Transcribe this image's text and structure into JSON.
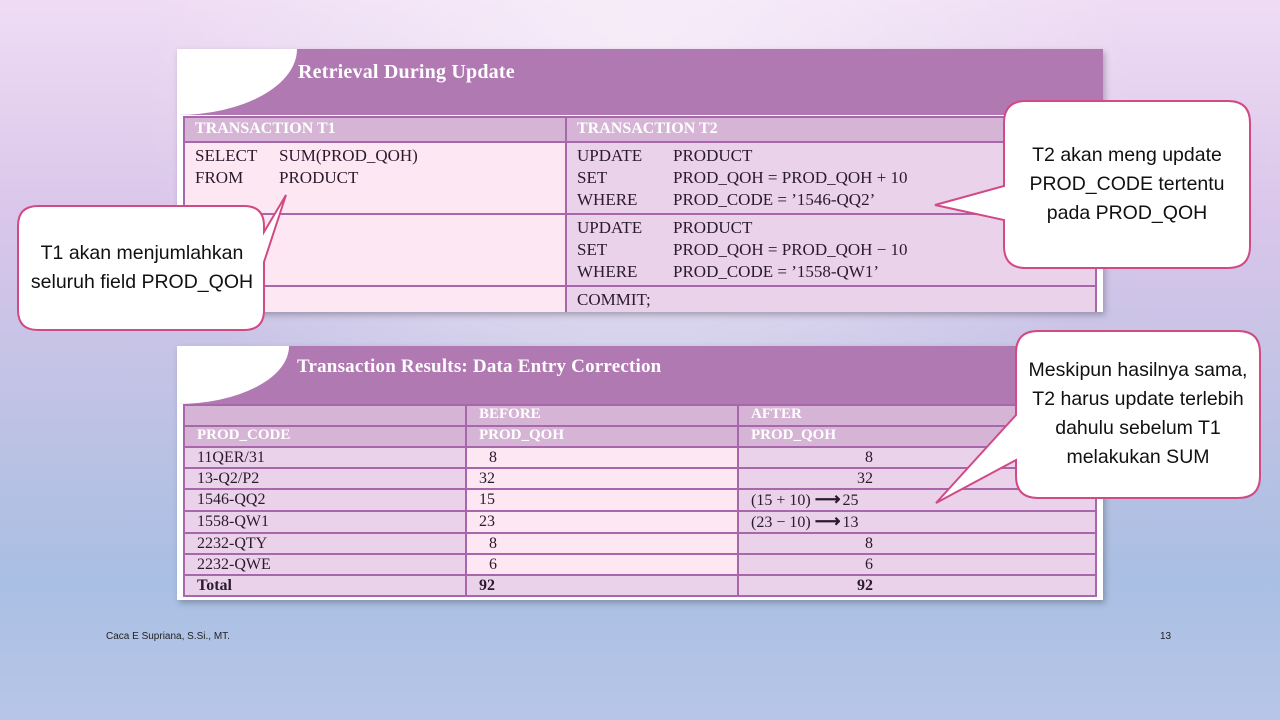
{
  "panel1": {
    "title": "Retrieval During Update",
    "col_t1": "TRANSACTION T1",
    "col_t2": "TRANSACTION T2",
    "t1": [
      {
        "kw": "SELECT",
        "val": "SUM(PROD_QOH)"
      },
      {
        "kw": "FROM",
        "val": "PRODUCT"
      }
    ],
    "t2_block1": [
      {
        "kw": "UPDATE",
        "val": "PRODUCT"
      },
      {
        "kw": "SET",
        "val": "PROD_QOH = PROD_QOH + 10"
      },
      {
        "kw": "WHERE",
        "val": "PROD_CODE = ’1546-QQ2’"
      }
    ],
    "t2_block2": [
      {
        "kw": "UPDATE",
        "val": "PRODUCT"
      },
      {
        "kw": "SET",
        "val": "PROD_QOH = PROD_QOH − 10"
      },
      {
        "kw": "WHERE",
        "val": "PROD_CODE = ’1558-QW1’"
      }
    ],
    "commit": "COMMIT;"
  },
  "panel2": {
    "title": "Transaction Results: Data Entry Correction",
    "hdr_before": "BEFORE",
    "hdr_after": "AFTER",
    "col_code": "PROD_CODE",
    "col_qoh_before": "PROD_QOH",
    "col_qoh_after": "PROD_QOH",
    "rows": [
      {
        "code": "11QER/31",
        "before": "8",
        "calc": "",
        "after": "8"
      },
      {
        "code": "13-Q2/P2",
        "before": "32",
        "calc": "",
        "after": "32"
      },
      {
        "code": "1546-QQ2",
        "before": "15",
        "calc": "(15 + 10)",
        "after": "25"
      },
      {
        "code": "1558-QW1",
        "before": "23",
        "calc": "(23 − 10)",
        "after": "13"
      },
      {
        "code": "2232-QTY",
        "before": "8",
        "calc": "",
        "after": "8"
      },
      {
        "code": "2232-QWE",
        "before": "6",
        "calc": "",
        "after": "6"
      }
    ],
    "total_label": "Total",
    "total_before": "92",
    "total_after": "92"
  },
  "callouts": {
    "t1": "T1 akan menjumlahkan seluruh field PROD_QOH",
    "t2": "T2 akan meng update PROD_CODE tertentu pada PROD_QOH",
    "result": "Meskipun hasilnya sama, T2 harus update terlebih dahulu sebelum T1 melakukan SUM"
  },
  "footer": {
    "author": "Caca E Supriana, S.Si., MT.",
    "page": "13"
  },
  "colors": {
    "header_purple": "#b179b2",
    "callout_border": "#d14a84"
  }
}
